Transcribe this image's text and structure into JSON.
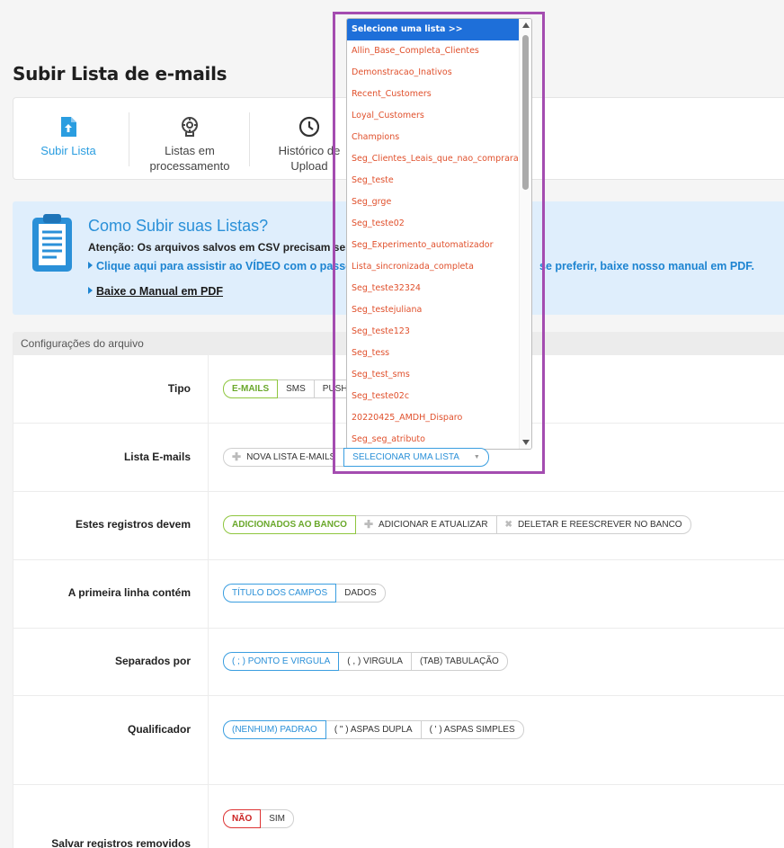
{
  "page": {
    "title": "Subir Lista de e-mails"
  },
  "tabs": [
    {
      "label": "Subir Lista",
      "icon": "upload-file-icon"
    },
    {
      "label_line1": "Listas em",
      "label_line2": "processamento",
      "icon": "gear-processing-icon"
    },
    {
      "label_line1": "Histórico de",
      "label_line2": "Upload",
      "icon": "clock-icon"
    }
  ],
  "info": {
    "icon": "document-icon",
    "title": "Como Subir suas Listas?",
    "warning": "Atenção: Os arquivos salvos em CSV precisam ser atrela",
    "video_link": "Clique aqui para assistir ao VÍDEO com o passo-a",
    "video_link_tail": "se preferir, baixe nosso manual em PDF.",
    "manual_link": "Baixe o Manual em PDF"
  },
  "config": {
    "header": "Configurações do arquivo",
    "rows": {
      "tipo": {
        "label": "Tipo",
        "options": [
          "E-MAILS",
          "SMS",
          "PUSH"
        ]
      },
      "lista": {
        "label": "Lista E-mails",
        "new_button": "NOVA LISTA E-MAILS",
        "select_button": "SELECIONAR UMA LISTA"
      },
      "registros": {
        "label": "Estes registros devem",
        "options": [
          "ADICIONADOS AO BANCO",
          "ADICIONAR E ATUALIZAR",
          "DELETAR E REESCREVER NO BANCO"
        ]
      },
      "primeira_linha": {
        "label": "A primeira linha contém",
        "options": [
          "TÍTULO DOS CAMPOS",
          "DADOS"
        ]
      },
      "separados": {
        "label": "Separados por",
        "options": [
          "( ; ) PONTO E VIRGULA",
          "( , ) VIRGULA",
          "(TAB) TABULAÇÃO"
        ]
      },
      "qualificador": {
        "label": "Qualificador",
        "options": [
          "(NENHUM) PADRAO",
          "( \" ) ASPAS DUPLA",
          "( ' ) ASPAS SIMPLES"
        ]
      },
      "salvar": {
        "label": "Salvar registros removidos",
        "options": [
          "NÃO",
          "SIM"
        ]
      }
    }
  },
  "dropdown": {
    "items": [
      "Selecione uma lista >>",
      "Allin_Base_Completa_Clientes",
      "Demonstracao_Inativos",
      "Recent_Customers",
      "Loyal_Customers",
      "Champions",
      "Seg_Clientes_Leais_que_nao_compraram",
      "Seg_teste",
      "Seg_grge",
      "Seg_teste02",
      "Seg_Experimento_automatizador",
      "Lista_sincronizada_completa",
      "Seg_teste32324",
      "Seg_testejuliana",
      "Seg_teste123",
      "Seg_tess",
      "Seg_test_sms",
      "Seg_teste02c",
      "20220425_AMDH_Disparo",
      "Seg_seg_atributo"
    ]
  },
  "colors": {
    "accent": "#2a9de0",
    "green": "#8fc63f",
    "red": "#dd3333",
    "highlight": "#a44cb0",
    "dropdown_item": "#e0502c",
    "selected": "#1e6fd9"
  }
}
